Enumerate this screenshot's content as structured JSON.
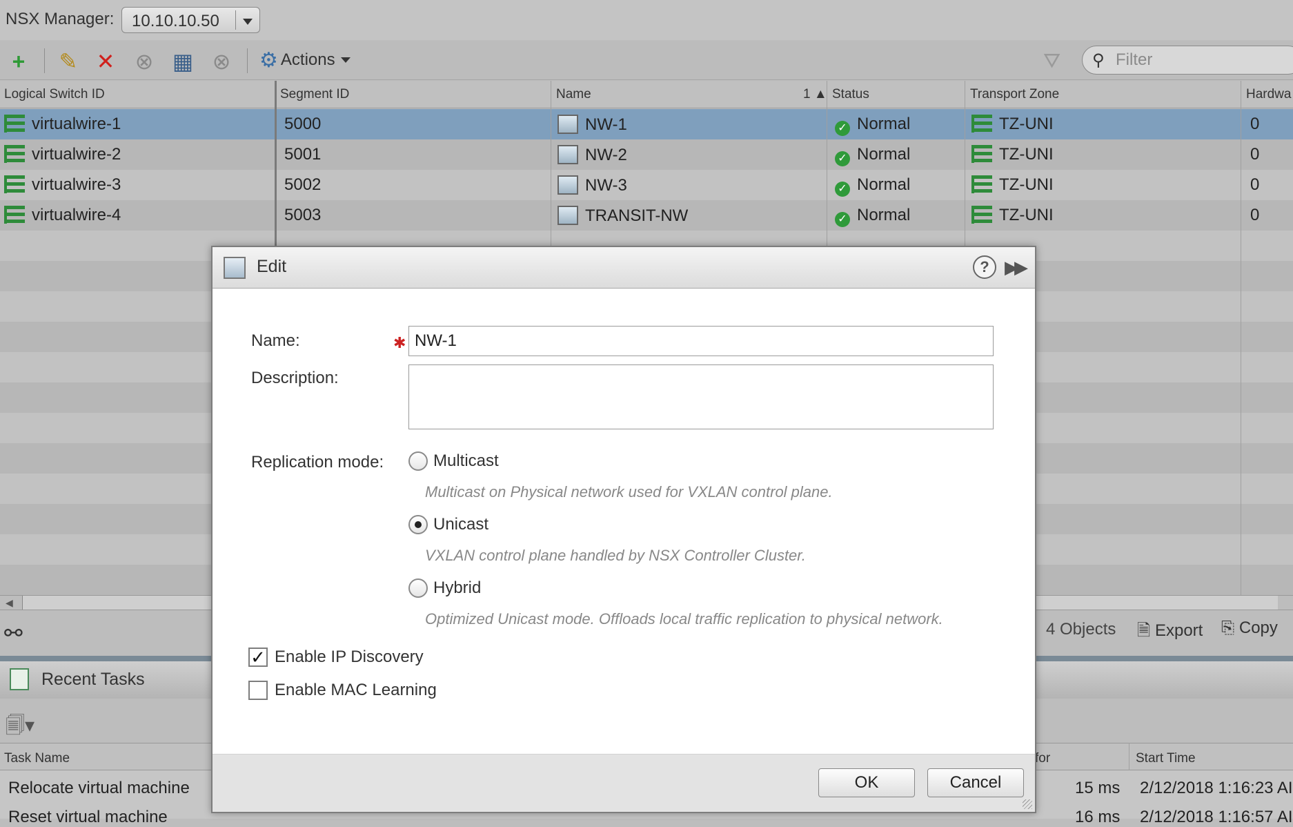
{
  "manager": {
    "label": "NSX Manager:",
    "selected": "10.10.10.50"
  },
  "toolbar": {
    "icons": [
      "add-icon",
      "edit-icon",
      "delete-icon",
      "disconnect-icon",
      "remove-vm-icon",
      "block-icon"
    ],
    "actions_label": "Actions",
    "filter_placeholder": "Filter"
  },
  "grid": {
    "columns": [
      "Logical Switch ID",
      "Segment ID",
      "Name",
      "Status",
      "Transport Zone",
      "Hardwa"
    ],
    "sort_indicator": "1 ▲",
    "rows": [
      {
        "id": "virtualwire-1",
        "segment": "5000",
        "name": "NW-1",
        "status": "Normal",
        "zone": "TZ-UNI",
        "hw": "0"
      },
      {
        "id": "virtualwire-2",
        "segment": "5001",
        "name": "NW-2",
        "status": "Normal",
        "zone": "TZ-UNI",
        "hw": "0"
      },
      {
        "id": "virtualwire-3",
        "segment": "5002",
        "name": "NW-3",
        "status": "Normal",
        "zone": "TZ-UNI",
        "hw": "0"
      },
      {
        "id": "virtualwire-4",
        "segment": "5003",
        "name": "TRANSIT-NW",
        "status": "Normal",
        "zone": "TZ-UNI",
        "hw": "0"
      }
    ],
    "object_count": "4 Objects",
    "export_label": "Export",
    "copy_label": "Copy"
  },
  "tasks": {
    "title": "Recent Tasks",
    "col_task_name": "Task Name",
    "col_for_fragment": "for",
    "col_start_time": "Start Time",
    "rows": [
      {
        "name": "Relocate virtual machine",
        "duration": "15 ms",
        "start": "2/12/2018 1:16:23 AI"
      },
      {
        "name": "Reset virtual machine",
        "duration": "16 ms",
        "start": "2/12/2018 1:16:57 AI"
      }
    ]
  },
  "dialog": {
    "title": "Edit",
    "name_label": "Name:",
    "name_value": "NW-1",
    "description_label": "Description:",
    "description_value": "",
    "replication_label": "Replication mode:",
    "options": [
      {
        "label": "Multicast",
        "desc": "Multicast on Physical network used for VXLAN control plane.",
        "selected": false
      },
      {
        "label": "Unicast",
        "desc": "VXLAN control plane handled by NSX Controller Cluster.",
        "selected": true
      },
      {
        "label": "Hybrid",
        "desc": "Optimized Unicast mode. Offloads local traffic replication to physical network.",
        "selected": false
      }
    ],
    "ip_discovery_label": "Enable IP Discovery",
    "ip_discovery_checked": true,
    "mac_learning_label": "Enable MAC Learning",
    "mac_learning_checked": false,
    "ok_label": "OK",
    "cancel_label": "Cancel"
  },
  "colors": {
    "selected_row": "#7f9fbd",
    "row_even": "#b7b7b7",
    "row_odd": "#c2c2c2",
    "status_ok": "#2f9a3a",
    "delete_red": "#d0201c",
    "add_green": "#2e9a36"
  }
}
